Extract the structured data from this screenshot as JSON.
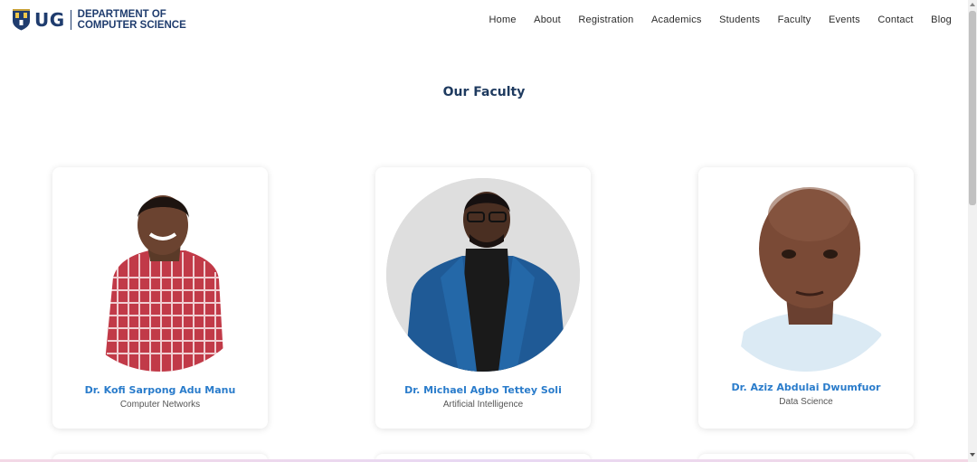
{
  "header": {
    "logo_abbr": "UG",
    "logo_line1": "DEPARTMENT OF",
    "logo_line2": "COMPUTER SCIENCE",
    "nav": [
      "Home",
      "About",
      "Registration",
      "Academics",
      "Students",
      "Faculty",
      "Events",
      "Contact",
      "Blog"
    ]
  },
  "section_title": "Our Faculty",
  "faculty": [
    {
      "name": "Dr. Kofi Sarpong Adu Manu",
      "field": "Computer Networks"
    },
    {
      "name": "Dr. Michael Agbo Tettey Soli",
      "field": "Artificial Intelligence"
    },
    {
      "name": "Dr. Aziz Abdulai Dwumfuor",
      "field": "Data Science"
    }
  ],
  "colors": {
    "brand_navy": "#1f3c6e",
    "title": "#1e3a5f",
    "name_blue": "#2a7ccb"
  },
  "icons": {
    "logo": "university-crest-icon",
    "scroll_up": "scroll-up-arrow-icon",
    "scroll_down": "scroll-down-arrow-icon"
  }
}
